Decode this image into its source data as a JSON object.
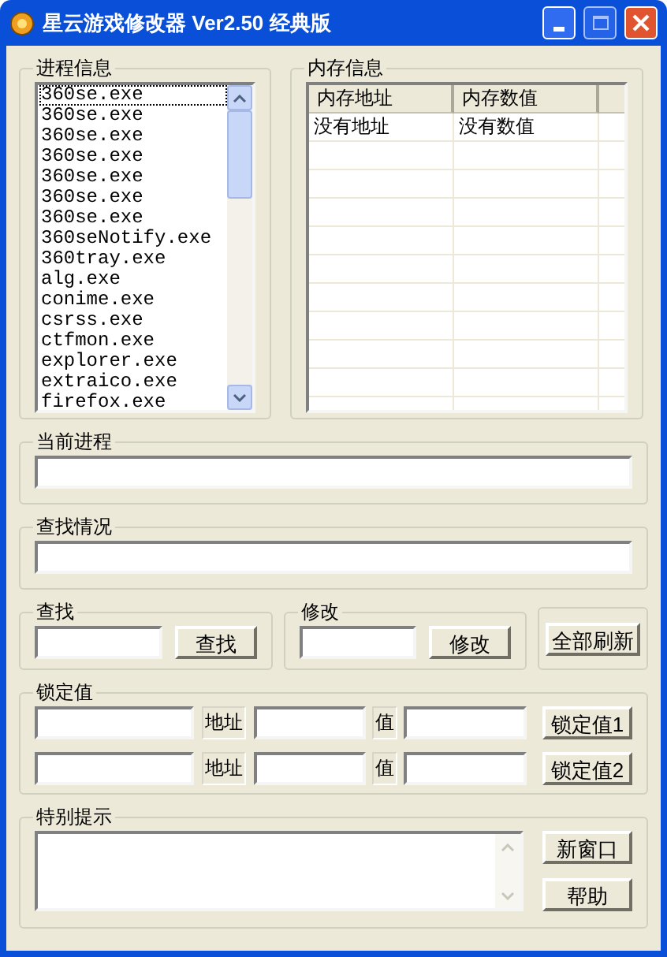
{
  "window": {
    "title": "星云游戏修改器 Ver2.50 经典版"
  },
  "process_group": {
    "title": "进程信息",
    "processes": [
      {
        "name": "360se.exe",
        "selected": true
      },
      {
        "name": "360se.exe",
        "selected": false
      },
      {
        "name": "360se.exe",
        "selected": false
      },
      {
        "name": "360se.exe",
        "selected": false
      },
      {
        "name": "360se.exe",
        "selected": false
      },
      {
        "name": "360se.exe",
        "selected": false
      },
      {
        "name": "360se.exe",
        "selected": false
      },
      {
        "name": "360seNotify.exe",
        "selected": false
      },
      {
        "name": "360tray.exe",
        "selected": false
      },
      {
        "name": "alg.exe",
        "selected": false
      },
      {
        "name": "conime.exe",
        "selected": false
      },
      {
        "name": "csrss.exe",
        "selected": false
      },
      {
        "name": "ctfmon.exe",
        "selected": false
      },
      {
        "name": "explorer.exe",
        "selected": false
      },
      {
        "name": "extraico.exe",
        "selected": false
      },
      {
        "name": "firefox.exe",
        "selected": false
      }
    ]
  },
  "memory_group": {
    "title": "内存信息",
    "columns": [
      "内存地址",
      "内存数值"
    ],
    "rows": [
      [
        "没有地址",
        "没有数值"
      ]
    ]
  },
  "current_process": {
    "title": "当前进程"
  },
  "search_status": {
    "title": "查找情况"
  },
  "search": {
    "title": "查找",
    "button": "查找"
  },
  "modify": {
    "title": "修改",
    "button": "修改"
  },
  "refresh_button": "全部刷新",
  "lock": {
    "title": "锁定值",
    "rows": [
      {
        "address_label": "地址",
        "value_label": "值",
        "button": "锁定值1"
      },
      {
        "address_label": "地址",
        "value_label": "值",
        "button": "锁定值2"
      }
    ]
  },
  "tips": {
    "title": "特别提示",
    "buttons": [
      "新窗口",
      "帮助"
    ]
  }
}
